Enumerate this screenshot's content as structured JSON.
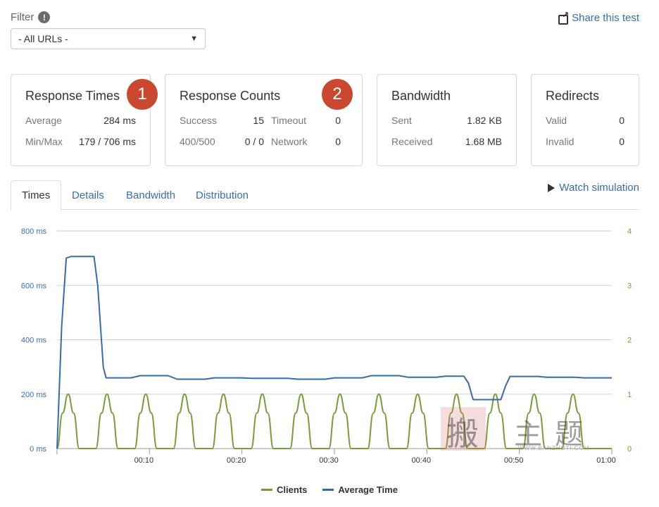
{
  "filter": {
    "label": "Filter",
    "info_icon": "!",
    "selected": "- All URLs -"
  },
  "share": {
    "label": "Share this test"
  },
  "cards": {
    "response_times": {
      "title": "Response Times",
      "badge": "1",
      "average_label": "Average",
      "average_value": "284 ms",
      "minmax_label": "Min/Max",
      "minmax_value": "179 / 706 ms"
    },
    "response_counts": {
      "title": "Response Counts",
      "badge": "2",
      "success_label": "Success",
      "success_value": "15",
      "timeout_label": "Timeout",
      "timeout_value": "0",
      "err_label": "400/500",
      "err_value": "0 / 0",
      "network_label": "Network",
      "network_value": "0"
    },
    "bandwidth": {
      "title": "Bandwidth",
      "sent_label": "Sent",
      "sent_value": "1.82 KB",
      "received_label": "Received",
      "received_value": "1.68 MB"
    },
    "redirects": {
      "title": "Redirects",
      "valid_label": "Valid",
      "valid_value": "0",
      "invalid_label": "Invalid",
      "invalid_value": "0"
    }
  },
  "tabs": [
    {
      "label": "Times",
      "active": true
    },
    {
      "label": "Details",
      "active": false
    },
    {
      "label": "Bandwidth",
      "active": false
    },
    {
      "label": "Distribution",
      "active": false
    }
  ],
  "watch": {
    "label": "Watch simulation"
  },
  "watermark": {
    "chars": [
      "搬",
      "主",
      "题"
    ],
    "url": "WWW.BANZHUTI.COM"
  },
  "chart_data": {
    "type": "line",
    "x_ticks": [
      "00:10",
      "00:20",
      "00:30",
      "00:40",
      "00:50",
      "01:00"
    ],
    "x_tick_values": [
      10,
      20,
      30,
      40,
      50,
      60
    ],
    "xlim": [
      0,
      60
    ],
    "y_left_ticks": [
      "0 ms",
      "200 ms",
      "400 ms",
      "600 ms",
      "800 ms"
    ],
    "y_left_values": [
      0,
      200,
      400,
      600,
      800
    ],
    "ylim_left": [
      0,
      800
    ],
    "y_right_ticks": [
      "0",
      "1",
      "2",
      "3",
      "4"
    ],
    "y_right_values": [
      0,
      1,
      2,
      3,
      4
    ],
    "ylim_right": [
      0,
      4
    ],
    "grid": true,
    "legend": "bottom-center",
    "series": [
      {
        "name": "Clients",
        "axis": "right",
        "color": "#7a9a3c",
        "x": [
          0,
          0.6,
          1.2,
          1.8,
          2.4,
          3.0,
          3.6,
          4.2,
          4.8,
          5.4,
          6.0,
          6.6,
          7.2,
          7.8,
          8.4,
          9.0,
          9.6,
          10.2,
          10.8,
          11.4,
          12.0,
          12.6,
          13.2,
          13.8,
          14.4,
          15.0,
          15.6,
          16.2,
          16.8,
          17.4,
          18.0,
          18.6,
          19.2,
          19.8,
          20.4,
          21.0,
          21.6,
          22.2,
          22.8,
          23.4,
          24.0,
          24.6,
          25.2,
          25.8,
          26.4,
          27.0,
          27.6,
          28.2,
          28.8,
          29.4,
          30.0,
          30.6,
          31.2,
          31.8,
          32.4,
          33.0,
          33.6,
          34.2,
          34.8,
          35.4,
          36.0,
          36.6,
          37.2,
          37.8,
          38.4,
          39.0,
          39.6,
          40.2,
          40.8,
          41.4,
          42.0,
          42.6,
          43.2,
          43.8,
          44.4,
          45.0,
          45.6,
          46.2,
          46.8,
          47.4,
          48.0,
          48.6,
          49.2,
          49.8,
          50.4,
          51.0,
          51.6,
          52.2,
          52.8,
          53.4,
          54.0,
          54.6,
          55.2,
          55.8,
          56.4,
          57.0,
          57.6,
          58.2,
          58.8,
          59.4,
          60.0
        ],
        "values": [
          0,
          0.65,
          1,
          0.65,
          0,
          0,
          0,
          0,
          0.65,
          1,
          0.65,
          0,
          0,
          0,
          0,
          0.65,
          1,
          0.65,
          0,
          0,
          0,
          0,
          0.65,
          1,
          0.65,
          0,
          0,
          0,
          0,
          0.65,
          1,
          0.65,
          0,
          0,
          0,
          0,
          0.65,
          1,
          0.65,
          0,
          0,
          0,
          0,
          0.65,
          1,
          0.65,
          0,
          0,
          0,
          0,
          0.65,
          1,
          0.65,
          0,
          0,
          0,
          0,
          0.65,
          1,
          0.65,
          0,
          0,
          0,
          0,
          0.65,
          1,
          0.65,
          0,
          0,
          0,
          0,
          0.65,
          1,
          0.65,
          0,
          0,
          0,
          0,
          0.65,
          1,
          0.65,
          0,
          0,
          0,
          0,
          0.65,
          1,
          0.65,
          0,
          0,
          0,
          0,
          0.65,
          1,
          0.65,
          0,
          0,
          0,
          0,
          0,
          0
        ]
      },
      {
        "name": "Average Time",
        "axis": "left",
        "color": "#3b6ba5",
        "x": [
          0,
          0.5,
          1,
          1.5,
          2,
          4,
          4.4,
          5,
          5.3,
          8,
          9,
          12,
          13,
          16,
          17,
          20,
          21,
          25,
          26,
          29,
          30,
          33,
          34,
          37,
          38,
          41,
          42,
          44,
          44.5,
          45,
          48,
          48.5,
          49,
          52,
          53,
          56,
          57,
          60
        ],
        "values": [
          0,
          450,
          700,
          706,
          706,
          706,
          600,
          300,
          260,
          260,
          268,
          268,
          255,
          255,
          260,
          260,
          258,
          258,
          255,
          255,
          260,
          260,
          268,
          268,
          262,
          262,
          266,
          266,
          240,
          180,
          180,
          230,
          265,
          265,
          262,
          262,
          260,
          260
        ]
      }
    ]
  }
}
